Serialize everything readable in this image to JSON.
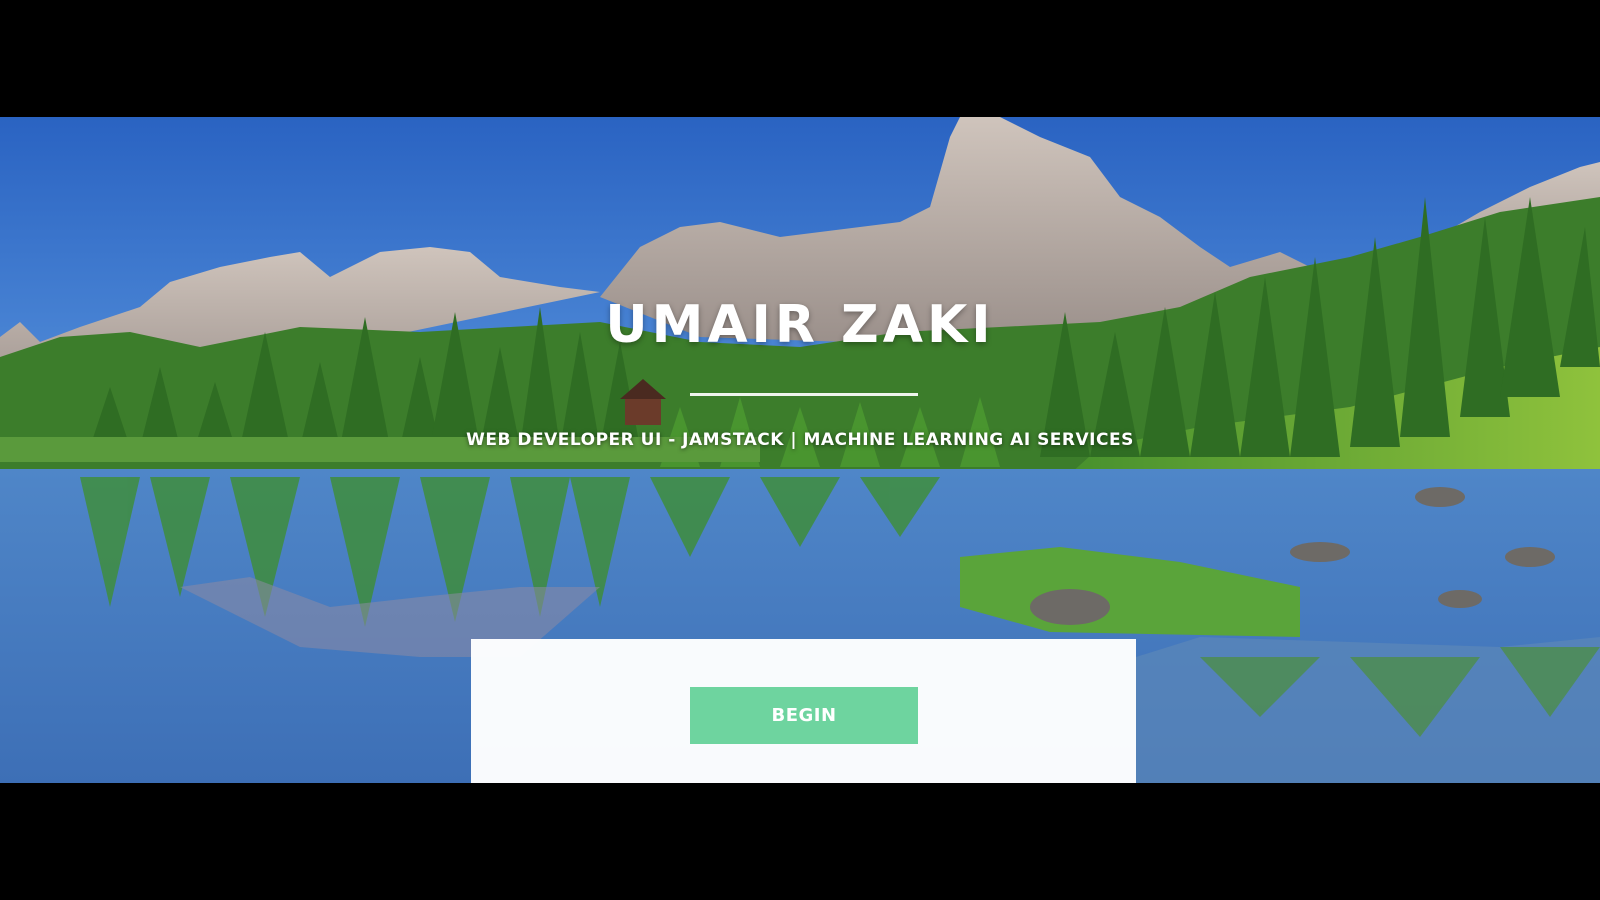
{
  "hero": {
    "title": "UMAIR ZAKI",
    "subtitle": "WEB DEVELOPER UI - JAMSTACK | MACHINE LEARNING AI SERVICES",
    "background": "mountain-lake-landscape-photo"
  },
  "cta": {
    "begin_label": "BEGIN"
  },
  "colors": {
    "button": "#6ed49f",
    "sky": "#2f6fc9",
    "panel": "#ffffff"
  }
}
